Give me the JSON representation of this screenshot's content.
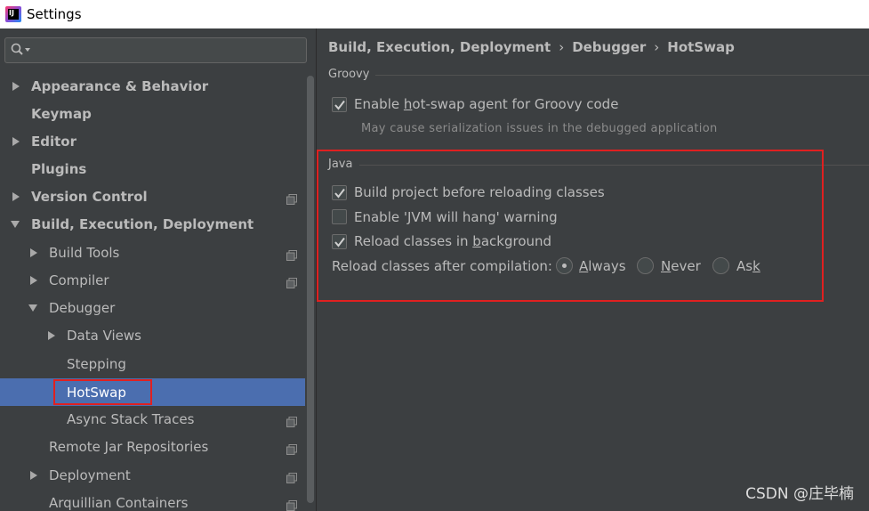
{
  "window": {
    "title": "Settings",
    "app_icon_letters": "IJ"
  },
  "search": {
    "value": "",
    "placeholder": ""
  },
  "tree": [
    {
      "label": "Appearance & Behavior",
      "bold": true,
      "arrow": "right"
    },
    {
      "label": "Keymap",
      "bold": true,
      "arrow": ""
    },
    {
      "label": "Editor",
      "bold": true,
      "arrow": "right"
    },
    {
      "label": "Plugins",
      "bold": true,
      "arrow": ""
    },
    {
      "label": "Version Control",
      "bold": true,
      "arrow": "right",
      "copy": true
    },
    {
      "label": "Build, Execution, Deployment",
      "bold": true,
      "arrow": "down"
    },
    {
      "label": "Build Tools",
      "arrow": "right",
      "copy": true
    },
    {
      "label": "Compiler",
      "arrow": "right",
      "copy": true
    },
    {
      "label": "Debugger",
      "arrow": "down"
    },
    {
      "label": "Data Views",
      "arrow": "right"
    },
    {
      "label": "Stepping",
      "arrow": ""
    },
    {
      "label": "HotSwap",
      "arrow": "",
      "selected": true
    },
    {
      "label": "Async Stack Traces",
      "arrow": "",
      "copy": true
    },
    {
      "label": "Remote Jar Repositories",
      "arrow": "",
      "copy": true
    },
    {
      "label": "Deployment",
      "arrow": "right",
      "copy": true
    },
    {
      "label": "Arquillian Containers",
      "arrow": "",
      "copy": true
    }
  ],
  "breadcrumb": [
    "Build, Execution, Deployment",
    "Debugger",
    "HotSwap"
  ],
  "breadcrumb_sep": "›",
  "groovy": {
    "title": "Groovy",
    "enable_agent": {
      "pre": "Enable ",
      "u": "h",
      "post": "ot-swap agent for Groovy code",
      "checked": true
    },
    "hint": "May cause serialization issues in the debugged application"
  },
  "java": {
    "title": "Java",
    "build_before": {
      "label": "Build project before reloading classes",
      "checked": true
    },
    "jvm_warning": {
      "label": "Enable 'JVM will hang' warning",
      "checked": false
    },
    "reload_bg": {
      "pre": "Reload classes in ",
      "u": "b",
      "post": "ackground",
      "checked": true
    },
    "after_compilation": {
      "label": "Reload classes after compilation:",
      "options": [
        {
          "u": "A",
          "rest": "lways",
          "selected": true
        },
        {
          "u": "N",
          "rest": "ever",
          "selected": false
        },
        {
          "pre": "As",
          "u": "k",
          "selected": false
        }
      ]
    }
  },
  "watermark": "CSDN @庄毕楠",
  "colors": {
    "selection": "#4b6eaf",
    "highlight_border": "#e02020",
    "background": "#3c3f41"
  }
}
